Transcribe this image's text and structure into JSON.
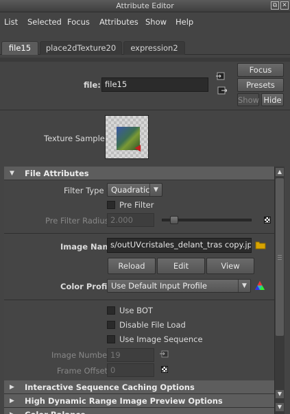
{
  "window": {
    "title": "Attribute Editor"
  },
  "menu": [
    "List",
    "Selected",
    "Focus",
    "Attributes",
    "Show",
    "Help"
  ],
  "tabs": [
    "file15",
    "place2dTexture20",
    "expression2"
  ],
  "header": {
    "node_label": "file:",
    "node_value": "file15",
    "focus_button": "Focus",
    "presets_button": "Presets",
    "show_button": "Show",
    "hide_button": "Hide"
  },
  "texture_sample": {
    "label": "Texture Sample"
  },
  "file_attributes": {
    "title": "File Attributes",
    "filter_type_label": "Filter Type",
    "filter_type_value": "Quadratic",
    "pre_filter_label": "Pre Filter",
    "pre_filter_radius_label": "Pre Filter Radius",
    "pre_filter_radius_value": "2.000",
    "pre_filter_radius_level": 0.1,
    "image_name_label": "Image Name",
    "image_name_value": "s/outUVcristales_delant_tras copy.jpg",
    "reload_button": "Reload",
    "edit_button": "Edit",
    "view_button": "View",
    "color_profile_label": "Color Profile",
    "color_profile_value": "Use Default Input Profile",
    "use_bot_label": "Use BOT",
    "disable_file_load_label": "Disable File Load",
    "use_image_sequence_label": "Use Image Sequence",
    "image_number_label": "Image Number",
    "image_number_value": "19",
    "frame_offset_label": "Frame Offset",
    "frame_offset_value": "0"
  },
  "sections": [
    "Interactive Sequence Caching Options",
    "High Dynamic Range Image Preview Options",
    "Color Balance"
  ],
  "colors": {
    "accent_folder": "#d9a400",
    "section_header": "#5d5d5d",
    "field_bg": "#2b2b2b"
  }
}
